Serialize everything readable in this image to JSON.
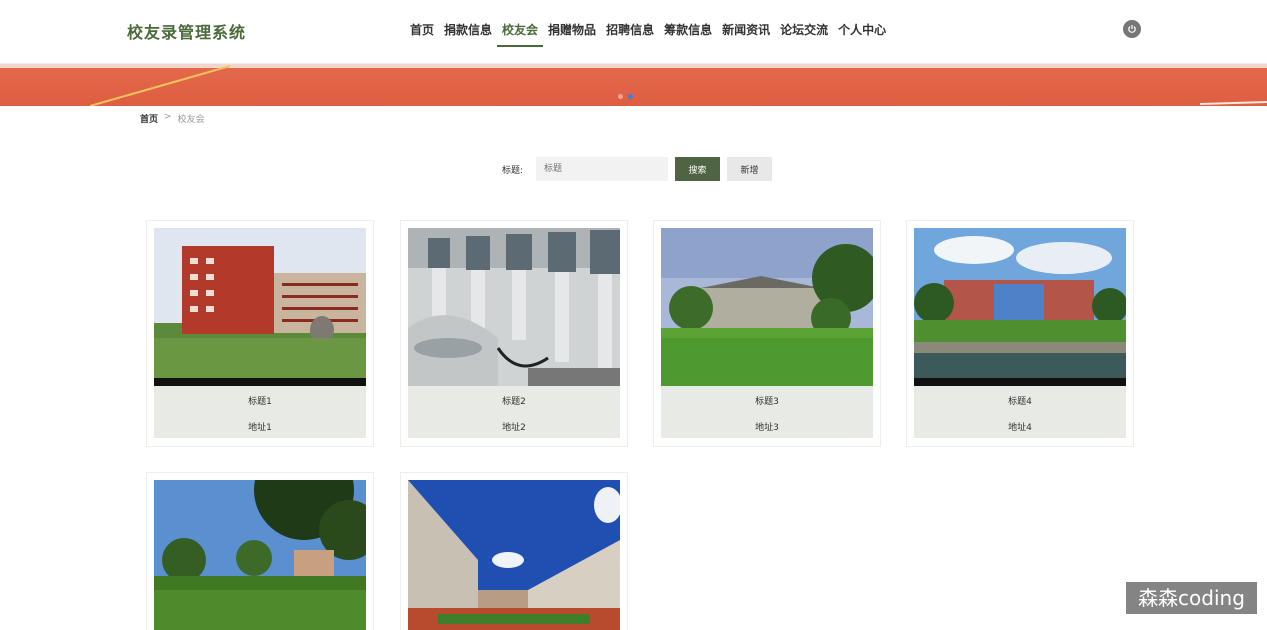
{
  "header": {
    "logo": "校友录管理系统",
    "nav": [
      "首页",
      "捐款信息",
      "校友会",
      "捐赠物品",
      "招聘信息",
      "筹款信息",
      "新闻资讯",
      "论坛交流",
      "个人中心"
    ],
    "active_nav": "校友会",
    "power_icon": "power-icon"
  },
  "breadcrumb": {
    "home": "首页",
    "separator": ">",
    "current": "校友会"
  },
  "search": {
    "label": "标题:",
    "placeholder": "标题",
    "search_button": "搜索",
    "add_button": "新增"
  },
  "cards": [
    {
      "title": "标题1",
      "address": "地址1"
    },
    {
      "title": "标题2",
      "address": "地址2"
    },
    {
      "title": "标题3",
      "address": "地址3"
    },
    {
      "title": "标题4",
      "address": "地址4"
    },
    {
      "title": "",
      "address": ""
    },
    {
      "title": "",
      "address": ""
    }
  ],
  "watermark": "森森coding",
  "colors": {
    "accent": "#4e6442",
    "banner": "#e0603f",
    "active_dot": "#3b7fe0"
  }
}
